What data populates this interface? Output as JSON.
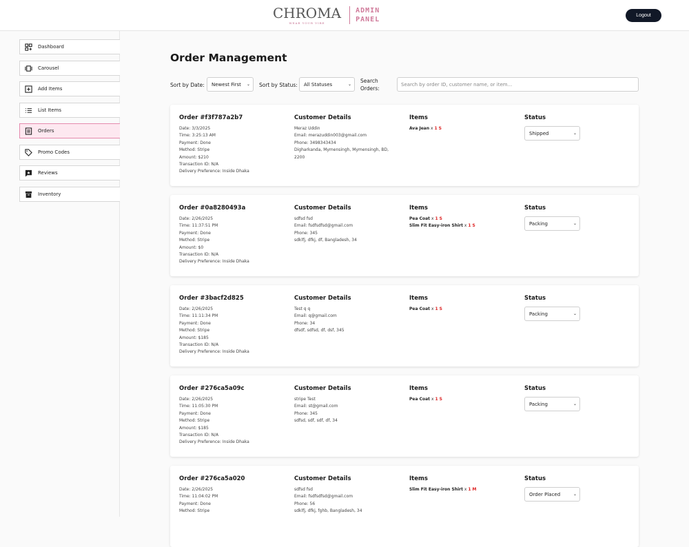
{
  "header": {
    "logo_text": "CHROMA",
    "logo_tagline": "WEAR YOUR VIBE",
    "admin_line1": "ADMIN",
    "admin_line2": "PANEL",
    "logout_label": "Logout"
  },
  "sidebar": {
    "items": [
      {
        "label": "Dashboard",
        "icon": "dashboard-icon"
      },
      {
        "label": "Carousel",
        "icon": "carousel-icon"
      },
      {
        "label": "Add Items",
        "icon": "add-box-icon"
      },
      {
        "label": "List Items",
        "icon": "list-icon"
      },
      {
        "label": "Orders",
        "icon": "orders-icon",
        "active": true
      },
      {
        "label": "Promo Codes",
        "icon": "tag-icon"
      },
      {
        "label": "Reviews",
        "icon": "reviews-icon"
      },
      {
        "label": "Inventory",
        "icon": "inventory-icon"
      }
    ]
  },
  "main": {
    "title": "Order Management",
    "filters": {
      "sort_date_label": "Sort by Date:",
      "sort_date_value": "Newest First",
      "sort_status_label": "Sort by Status:",
      "sort_status_value": "All Statuses",
      "search_label_1": "Search",
      "search_label_2": "Orders:",
      "search_placeholder": "Search by order ID, customer name, or item..."
    },
    "headings": {
      "customer": "Customer Details",
      "items": "Items",
      "status": "Status"
    },
    "orders": [
      {
        "title": "Order #f3f787a2b7",
        "date": "Date: 3/3/2025",
        "time": "Time: 3:25:13 AM",
        "payment": "Payment: Done",
        "method": "Method: Stripe",
        "amount": "Amount: $210",
        "transaction": "Transaction ID: N/A",
        "delivery": "Delivery Preference: Inside Dhaka",
        "customer": {
          "name": "Meraz Uddin",
          "email": "Email: merazuddin003@gmail.com",
          "phone": "Phone: 3498343434",
          "address1": "Digharkanda, Mymensingh, Mymensingh, BD,",
          "address2": "2200"
        },
        "items": [
          {
            "name": "Ava Jean",
            "x": "x",
            "qty": "1",
            "size": "S"
          }
        ],
        "status": "Shipped"
      },
      {
        "title": "Order #0a8280493a",
        "date": "Date: 2/26/2025",
        "time": "Time: 11:37:51 PM",
        "payment": "Payment: Done",
        "method": "Method: Stripe",
        "amount": "Amount: $0",
        "transaction": "Transaction ID: N/A",
        "delivery": "Delivery Preference: Inside Dhaka",
        "customer": {
          "name": "sdfsd fsd",
          "email": "Email: fsdfsdfsd@gmail.com",
          "phone": "Phone: 345",
          "address1": "sdklfj, dfkj, df, Bangladesh, 34",
          "address2": ""
        },
        "items": [
          {
            "name": "Pea Coat",
            "x": "x",
            "qty": "1",
            "size": "S"
          },
          {
            "name": "Slim Fit Easy-iron Shirt",
            "x": "x",
            "qty": "1",
            "size": "S"
          }
        ],
        "status": "Packing"
      },
      {
        "title": "Order #3bacf2d825",
        "date": "Date: 2/26/2025",
        "time": "Time: 11:11:34 PM",
        "payment": "Payment: Done",
        "method": "Method: Stripe",
        "amount": "Amount: $185",
        "transaction": "Transaction ID: N/A",
        "delivery": "Delivery Preference: Inside Dhaka",
        "customer": {
          "name": "Test q q",
          "email": "Email: q@gmail.com",
          "phone": "Phone: 34",
          "address1": "dfsdf, sdfsd, df, dsf, 345",
          "address2": ""
        },
        "items": [
          {
            "name": "Pea Coat",
            "x": "x",
            "qty": "1",
            "size": "S"
          }
        ],
        "status": "Packing"
      },
      {
        "title": "Order #276ca5a09c",
        "date": "Date: 2/26/2025",
        "time": "Time: 11:05:30 PM",
        "payment": "Payment: Done",
        "method": "Method: Stripe",
        "amount": "Amount: $185",
        "transaction": "Transaction ID: N/A",
        "delivery": "Delivery Preference: Inside Dhaka",
        "customer": {
          "name": "stripe Test",
          "email": "Email: st@gmail.com",
          "phone": "Phone: 345",
          "address1": "sdfsd, sdf, sdf, df, 34",
          "address2": ""
        },
        "items": [
          {
            "name": "Pea Coat",
            "x": "x",
            "qty": "1",
            "size": "S"
          }
        ],
        "status": "Packing"
      },
      {
        "title": "Order #276ca5a020",
        "date": "Date: 2/26/2025",
        "time": "Time: 11:04:02 PM",
        "payment": "Payment: Done",
        "method": "Method: Stripe",
        "amount": "",
        "transaction": "",
        "delivery": "",
        "customer": {
          "name": "sdfsd fsd",
          "email": "Email: fsdfsdfsd@gmail.com",
          "phone": "Phone: 56",
          "address1": "sdklfj, dfkj, fghb, Bangladesh, 34",
          "address2": ""
        },
        "items": [
          {
            "name": "Slim Fit Easy-iron Shirt",
            "x": "x",
            "qty": "1",
            "size": "M"
          }
        ],
        "status": "Order Placed"
      }
    ]
  },
  "colors": {
    "accent_pink": "#d07a9a",
    "active_bg": "#fde8f0",
    "logout_bg": "#111827",
    "qty_size_red": "#dd2222"
  }
}
